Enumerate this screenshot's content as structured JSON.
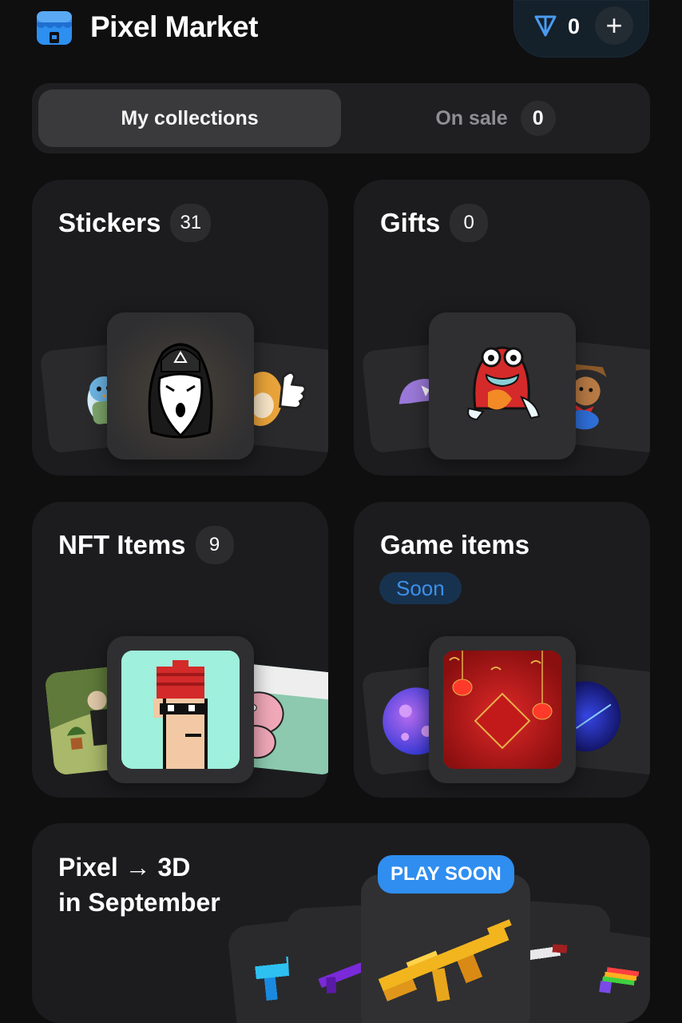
{
  "header": {
    "title": "Pixel Market",
    "balance": "0",
    "add_label": "+"
  },
  "tabs": {
    "my_collections": "My collections",
    "on_sale": "On sale",
    "on_sale_count": "0"
  },
  "cards": {
    "stickers": {
      "title": "Stickers",
      "count": "31"
    },
    "gifts": {
      "title": "Gifts",
      "count": "0"
    },
    "nft_items": {
      "title": "NFT Items",
      "count": "9"
    },
    "game_items": {
      "title": "Game items",
      "badge": "Soon"
    }
  },
  "promo": {
    "line1": "Pixel → 3D",
    "line2": "in September",
    "badge": "PLAY SOON"
  },
  "colors": {
    "background": "#0f0f10",
    "card": "#1c1c1e",
    "accent_blue": "#2f8ef0",
    "soon_text": "#3d8fe8"
  }
}
